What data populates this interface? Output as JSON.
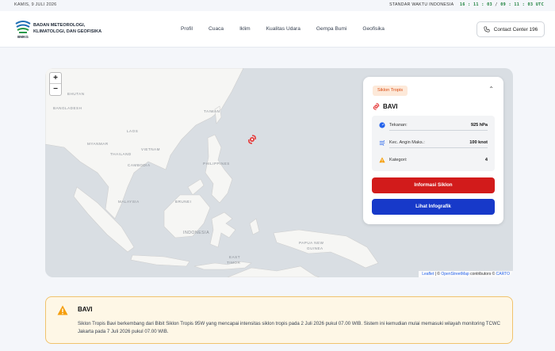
{
  "topbar": {
    "date": "KAMIS, 9 JULI 2026",
    "time_label": "STANDAR WAKTU INDONESIA",
    "time_wib": "16 : 11 : 03",
    "time_utc": "09 : 11 : 03 UTC"
  },
  "header": {
    "brand_line1": "BADAN METEOROLOGI,",
    "brand_line2": "KLIMATOLOGI, DAN GEOFISIKA",
    "logo_text": "BMKG",
    "nav": [
      "Profil",
      "Cuaca",
      "Iklim",
      "Kualitas Udara",
      "Gempa Bumi",
      "Geofisika"
    ],
    "contact_label": "Contact Center 196"
  },
  "map": {
    "zoom_in": "+",
    "zoom_out": "−",
    "attribution_leaflet": "Leaflet",
    "attribution_sep": " | © ",
    "attribution_osm": "OpenStreetMap",
    "attribution_contrib": " contributors © ",
    "attribution_carto": "CARTO",
    "labels": {
      "bhutan": "BHUTAN",
      "bangladesh": "BANGLADESH",
      "laos": "LAOS",
      "myanmar": "MYANMAR",
      "vietnam": "VIETNAM",
      "thailand": "THAILAND",
      "cambodia": "CAMBODIA",
      "taiwan": "TAIWAN",
      "philippines": "PHILIPPINES",
      "malaysia": "MALAYSIA",
      "brunei": "BRUNEI",
      "indonesia": "INDONESIA",
      "png1": "PAPUA NEW",
      "png2": "GUINEA",
      "east1": "EAST",
      "east2": "TIMOR"
    }
  },
  "panel": {
    "badge": "Siklon Tropis",
    "name": "BAVI",
    "rows": [
      {
        "label": "Tekanan:",
        "value": "925 hPa"
      },
      {
        "label": "Kec. Angin Maks.:",
        "value": "100 knot"
      },
      {
        "label": "Kategori:",
        "value": "4"
      }
    ],
    "btn_info": "Informasi Siklon",
    "btn_infographic": "Lihat Infografik"
  },
  "alert": {
    "title": "BAVI",
    "text": "Siklon Tropis Bavi berkembang dari Bibit Siklon Tropis 95W yang mencapai intensitas siklon tropis pada 2 Juli 2026 pukul 07.00 WIB. Sistem ini kemudian mulai memasuki wilayah monitoring TCWC Jakarta pada 7 Juli 2026 pukul 07.00 WIB."
  },
  "colors": {
    "primary_red": "#d21b1b",
    "primary_blue": "#1739c9",
    "badge_orange": "#d9480f",
    "time_green": "#1a7f3a"
  }
}
